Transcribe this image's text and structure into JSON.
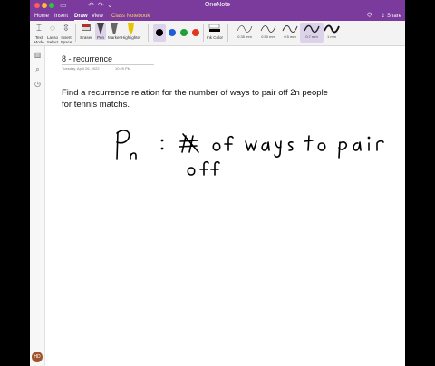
{
  "app": {
    "title": "OneNote"
  },
  "menu_tabs": [
    {
      "label": "Home"
    },
    {
      "label": "Insert"
    },
    {
      "label": "Draw",
      "active": true
    },
    {
      "label": "View"
    },
    {
      "label": "Class Notebook"
    }
  ],
  "share_label": "Share",
  "ribbon": {
    "text_mode": "Text Mode",
    "lasso_select": "Lasso Select",
    "insert_space": "Insert Space",
    "eraser": "Eraser",
    "pen": "Pen",
    "marker": "Marker",
    "highlighter": "Highlighter",
    "ink_color": "Ink Color",
    "colors": [
      "#000000",
      "#1f5fd6",
      "#21a038",
      "#e0361f"
    ],
    "selected_color": "#000000",
    "thickness": [
      {
        "label": "0.35 mm"
      },
      {
        "label": "0.50 mm"
      },
      {
        "label": "0.5 mm"
      },
      {
        "label": "0.7 mm",
        "selected": true
      },
      {
        "label": "1 mm"
      }
    ]
  },
  "page": {
    "title": "8 - recurrence",
    "date": "Tuesday, April 26, 2022",
    "time": "10:29 PM",
    "body": "Find a recurrence relation for the number of ways to pair off 2n people for tennis matchs."
  },
  "user": {
    "initials": "HD"
  },
  "accent_color": "#7a3b9c"
}
